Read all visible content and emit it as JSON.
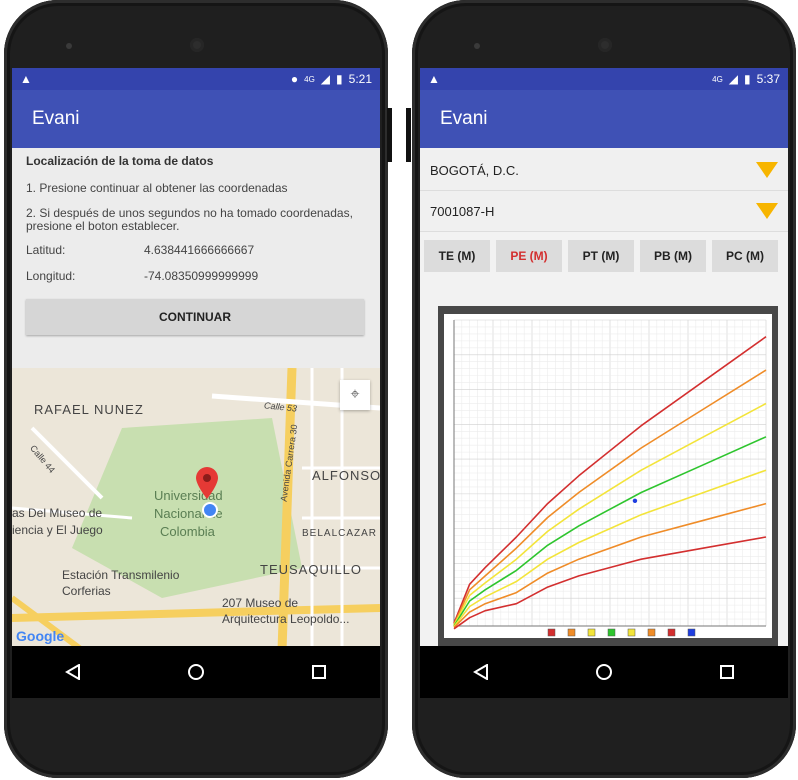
{
  "screen_a": {
    "status": {
      "time": "5:21",
      "network": "4G"
    },
    "app_title": "Evani",
    "heading": "Localización de la toma de datos",
    "instruction_1": "1. Presione continuar al obtener las coordenadas",
    "instruction_2": "2. Si después de unos segundos no ha tomado coordenadas, presione el boton establecer.",
    "lat_label": "Latitud:",
    "lat_value": "4.638441666666667",
    "lon_label": "Longitud:",
    "lon_value": "-74.08350999999999",
    "continue_label": "CONTINUAR",
    "map": {
      "labels": {
        "rafael": "RAFAEL NUNEZ",
        "calle53": "Calle 53",
        "calle44": "Calle 44",
        "alfonso": "ALFONSO",
        "carrera30": "Avenida Carrera 30",
        "universidad_1": "Universidad",
        "universidad_2": "Nacional de",
        "universidad_3": "Colombia",
        "museo_1": "as Del Museo de",
        "museo_2": "iencia y El Juego",
        "belalcazar": "BELALCAZAR",
        "teusaquillo": "TEUSAQUILLO",
        "transmilenio_1": "Estación Transmilenio",
        "transmilenio_2": "Corferias",
        "arq_1": "207 Museo de",
        "arq_2": "Arquitectura Leopoldo...",
        "google": "Google"
      }
    }
  },
  "screen_b": {
    "status": {
      "time": "5:37",
      "network": "4G"
    },
    "app_title": "Evani",
    "select_city": "BOGOTÁ, D.C.",
    "select_code": "7001087-H",
    "tabs": [
      {
        "label": "TE (M)",
        "color": "#222222"
      },
      {
        "label": "PE (M)",
        "color": "#d32f2f"
      },
      {
        "label": "PT (M)",
        "color": "#222222"
      },
      {
        "label": "PB (M)",
        "color": "#222222"
      },
      {
        "label": "PC (M)",
        "color": "#222222"
      }
    ]
  },
  "chart_data": {
    "type": "line",
    "title": "",
    "xlabel": "",
    "ylabel": "",
    "x": [
      0,
      0.5,
      1,
      2,
      3,
      4,
      6,
      8,
      10
    ],
    "series": [
      {
        "color": "#d32f2f",
        "values": [
          1.0,
          15.0,
          21.0,
          32.0,
          44.0,
          54.0,
          72.0,
          88.0,
          104.0
        ]
      },
      {
        "color": "#ef8c28",
        "values": [
          0.5,
          13.0,
          18.0,
          28.0,
          39.0,
          48.0,
          64.0,
          78.0,
          92.0
        ]
      },
      {
        "color": "#f3e43a",
        "values": [
          0.2,
          11.0,
          15.5,
          24.0,
          34.0,
          42.0,
          56.0,
          68.0,
          80.0
        ]
      },
      {
        "color": "#2ec52e",
        "values": [
          0.0,
          9.0,
          13.0,
          20.0,
          29.0,
          36.0,
          48.0,
          58.0,
          68.0
        ]
      },
      {
        "color": "#f3e43a",
        "values": [
          -0.2,
          7.0,
          10.5,
          16.0,
          24.0,
          30.0,
          40.0,
          48.0,
          56.0
        ]
      },
      {
        "color": "#ef8c28",
        "values": [
          -0.5,
          5.0,
          8.0,
          12.0,
          19.0,
          24.0,
          32.0,
          38.0,
          44.0
        ]
      },
      {
        "color": "#d32f2f",
        "values": [
          -1.0,
          3.0,
          5.5,
          8.0,
          14.0,
          18.0,
          24.0,
          28.0,
          32.0
        ]
      }
    ],
    "points": [
      {
        "x": 5.8,
        "y": 45.0,
        "color": "#1f3ee0"
      }
    ],
    "xlim": [
      0,
      10
    ],
    "ylim": [
      0,
      110
    ],
    "grid": true
  }
}
